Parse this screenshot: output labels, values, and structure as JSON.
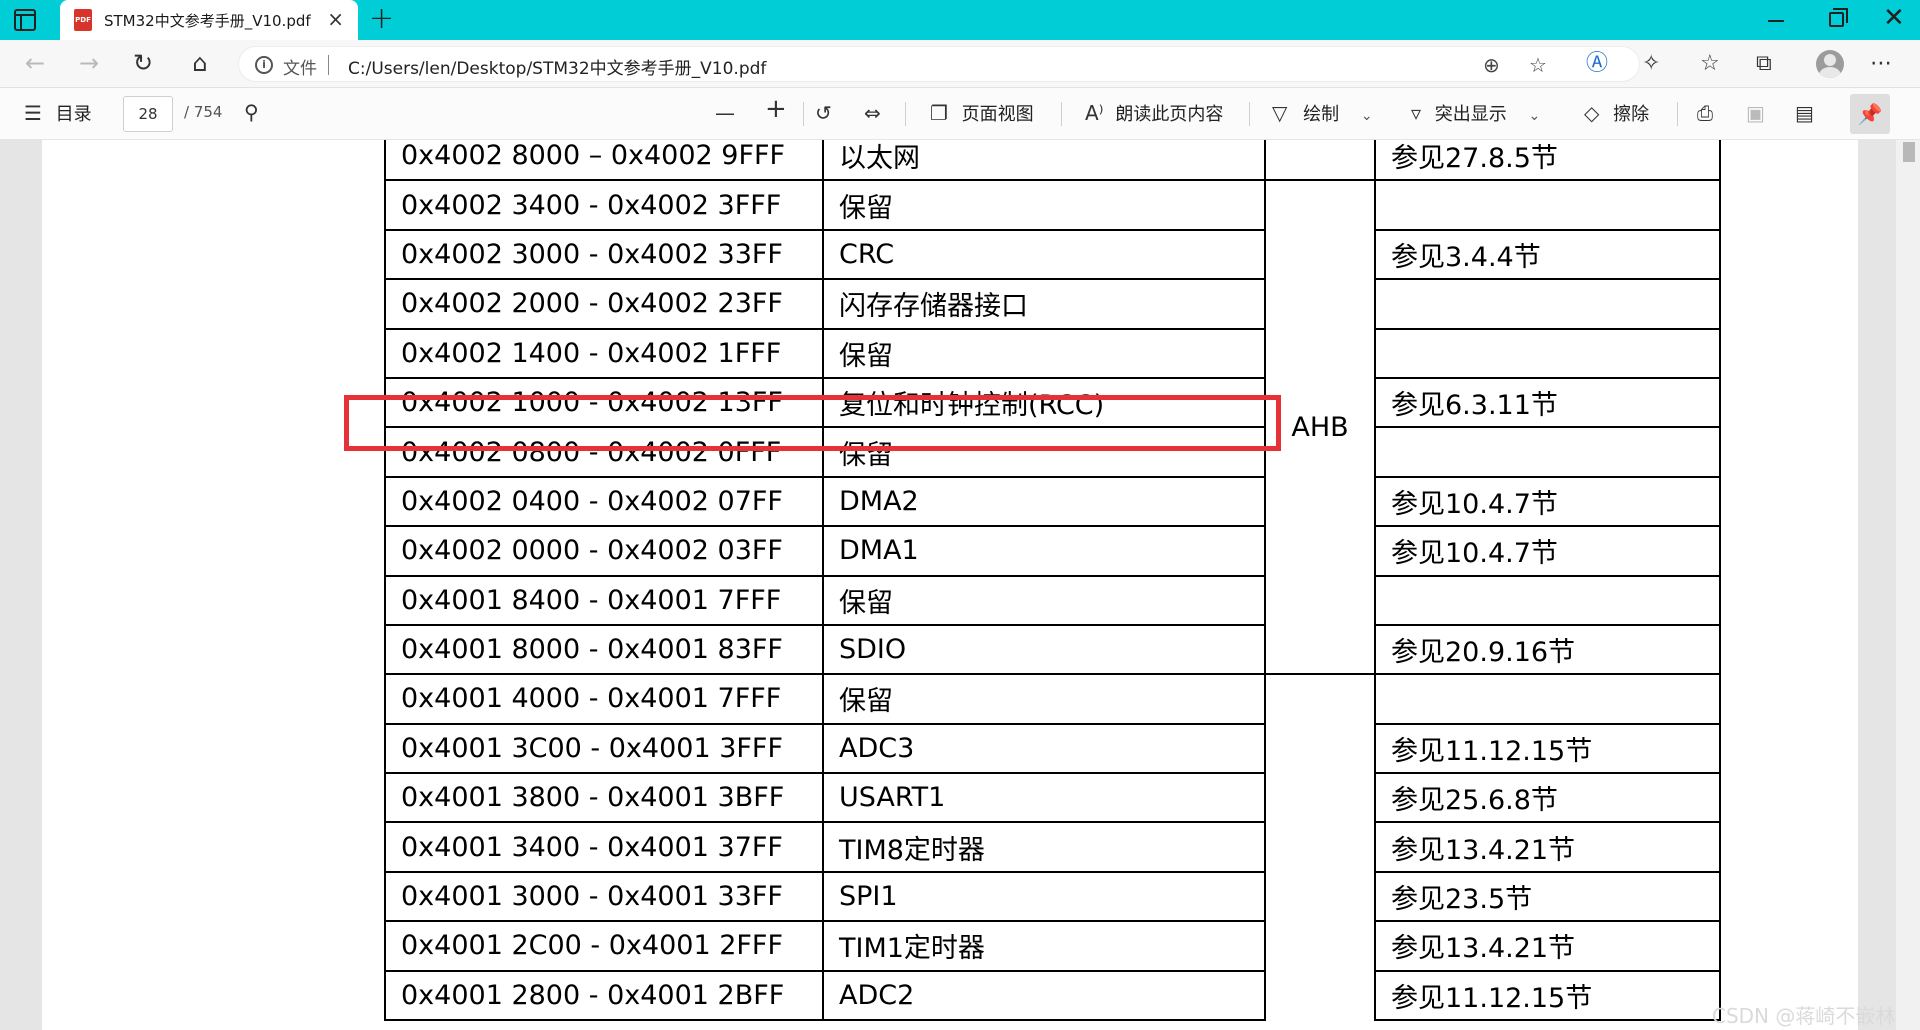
{
  "browser": {
    "tab_title": "STM32中文参考手册_V10.pdf",
    "tab_close": "×",
    "new_tab": "+",
    "file_label": "文件",
    "url": "C:/Users/len/Desktop/STM32中文参考手册_V10.pdf"
  },
  "pdf_toolbar": {
    "toc_label": "目录",
    "page_current": "28",
    "page_total": "/ 754",
    "page_view_label": "页面视图",
    "read_aloud_label": "朗读此页内容",
    "draw_label": "绘制",
    "highlight_label": "突出显示",
    "erase_label": "擦除"
  },
  "table": {
    "rows": [
      {
        "range": "0x4002 8000 – 0x4002 9FFF",
        "peripheral": "以太网",
        "ref": "参见27.8.5节"
      },
      {
        "range": "0x4002 3400 - 0x4002 3FFF",
        "peripheral": "保留",
        "ref": ""
      },
      {
        "range": "0x4002 3000 - 0x4002 33FF",
        "peripheral": "CRC",
        "ref": "参见3.4.4节"
      },
      {
        "range": "0x4002 2000 - 0x4002 23FF",
        "peripheral": "闪存存储器接口",
        "ref": ""
      },
      {
        "range": "0x4002 1400 - 0x4002 1FFF",
        "peripheral": "保留",
        "ref": ""
      },
      {
        "range": "0x4002 1000 - 0x4002 13FF",
        "peripheral": "复位和时钟控制(RCC)",
        "ref": "参见6.3.11节"
      },
      {
        "range": "0x4002 0800 - 0x4002 0FFF",
        "peripheral": "保留",
        "ref": ""
      },
      {
        "range": "0x4002 0400 - 0x4002 07FF",
        "peripheral": "DMA2",
        "ref": "参见10.4.7节"
      },
      {
        "range": "0x4002 0000 - 0x4002 03FF",
        "peripheral": "DMA1",
        "ref": "参见10.4.7节"
      },
      {
        "range": "0x4001 8400 - 0x4001 7FFF",
        "peripheral": "保留",
        "ref": ""
      },
      {
        "range": "0x4001 8000 - 0x4001 83FF",
        "peripheral": "SDIO",
        "ref": "参见20.9.16节"
      },
      {
        "range": "0x4001 4000 - 0x4001 7FFF",
        "peripheral": "保留",
        "ref": ""
      },
      {
        "range": "0x4001 3C00 - 0x4001 3FFF",
        "peripheral": "ADC3",
        "ref": "参见11.12.15节"
      },
      {
        "range": "0x4001 3800 - 0x4001 3BFF",
        "peripheral": "USART1",
        "ref": "参见25.6.8节"
      },
      {
        "range": "0x4001 3400 - 0x4001 37FF",
        "peripheral": "TIM8定时器",
        "ref": "参见13.4.21节"
      },
      {
        "range": "0x4001 3000 - 0x4001 33FF",
        "peripheral": "SPI1",
        "ref": "参见23.5节"
      },
      {
        "range": "0x4001 2C00 - 0x4001 2FFF",
        "peripheral": "TIM1定时器",
        "ref": "参见13.4.21节"
      },
      {
        "range": "0x4001 2800 - 0x4001 2BFF",
        "peripheral": "ADC2",
        "ref": "参见11.12.15节"
      }
    ],
    "bus_label": "AHB"
  },
  "watermark": "CSDN @蒋崎不嵌林"
}
